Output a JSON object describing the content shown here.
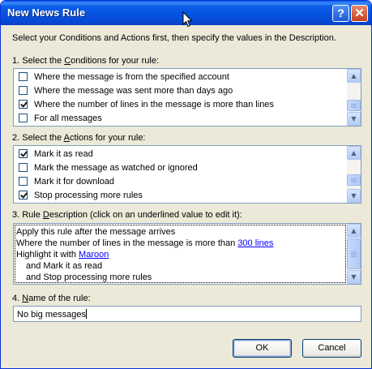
{
  "window": {
    "title": "New News Rule",
    "help_label": "?",
    "close_label": "✕"
  },
  "instructions": "Select your Conditions and Actions first, then specify the values in the Description.",
  "conditions": {
    "label_pre": "1. Select the ",
    "label_accel": "C",
    "label_post": "onditions for your rule:",
    "items": [
      {
        "label": "Where the message is from the specified account",
        "checked": false
      },
      {
        "label": "Where the message was sent more than days ago",
        "checked": false
      },
      {
        "label": "Where the number of lines in the message is more than lines",
        "checked": true
      },
      {
        "label": "For all messages",
        "checked": false
      }
    ]
  },
  "actions": {
    "label_pre": "2. Select the ",
    "label_accel": "A",
    "label_post": "ctions for your rule:",
    "items": [
      {
        "label": "Mark it as read",
        "checked": true
      },
      {
        "label": "Mark the message as watched or ignored",
        "checked": false
      },
      {
        "label": "Mark it for download",
        "checked": false
      },
      {
        "label": "Stop processing more rules",
        "checked": true
      }
    ]
  },
  "description": {
    "label_pre": "3. Rule ",
    "label_accel": "D",
    "label_post": "escription (click on an underlined value to edit it):",
    "line1": "Apply this rule after the message arrives",
    "line2_text": "Where the number of lines in the message is more than ",
    "line2_link": "300 lines",
    "line3_text": "Highlight it with ",
    "line3_link": "Maroon",
    "line4": "and Mark it as read",
    "line5": "and Stop processing more rules"
  },
  "name": {
    "label_pre": "4. ",
    "label_accel": "N",
    "label_post": "ame of the rule:",
    "value": "No big messages"
  },
  "buttons": {
    "ok": "OK",
    "cancel": "Cancel"
  },
  "colors": {
    "title_bar": "#0553df",
    "dialog_bg": "#ece9d8",
    "link": "#0000ff",
    "field_border": "#7f9db9"
  }
}
